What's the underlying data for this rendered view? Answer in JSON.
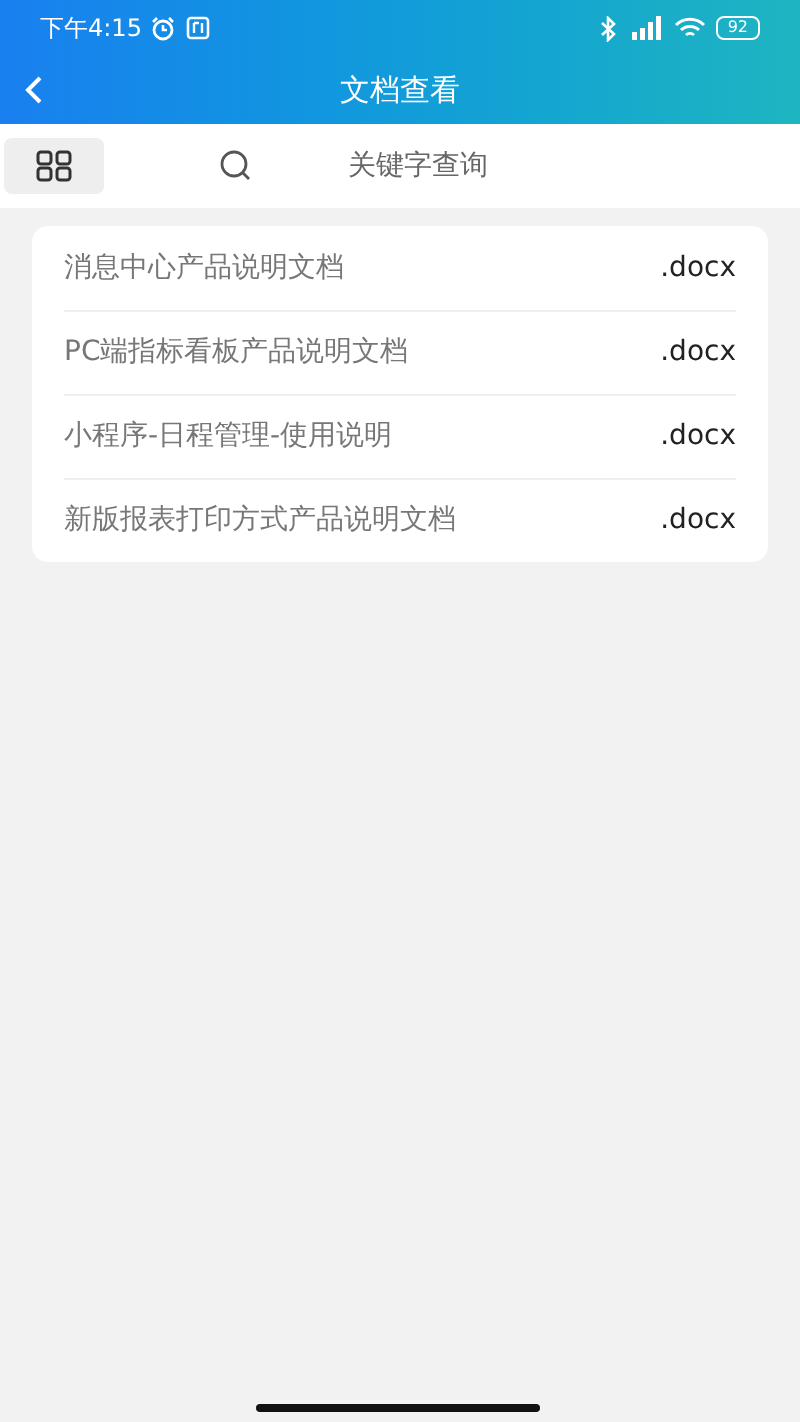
{
  "status_bar": {
    "time": "下午4:15",
    "battery": "92"
  },
  "header": {
    "title": "文档查看"
  },
  "search": {
    "placeholder": "关键字查询"
  },
  "documents": [
    {
      "name": "消息中心产品说明文档",
      "ext": ".docx"
    },
    {
      "name": "PC端指标看板产品说明文档",
      "ext": ".docx"
    },
    {
      "name": "小程序-日程管理-使用说明",
      "ext": ".docx"
    },
    {
      "name": "新版报表打印方式产品说明文档",
      "ext": ".docx"
    }
  ]
}
